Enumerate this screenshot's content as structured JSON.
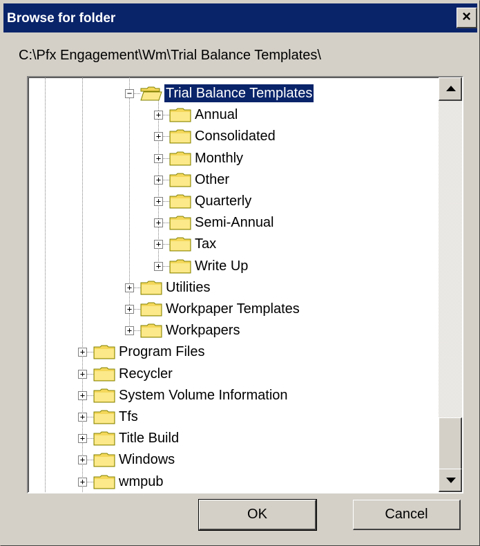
{
  "window": {
    "title": "Browse for folder",
    "close_label": "×"
  },
  "current_path": "C:\\Pfx Engagement\\Wm\\Trial Balance Templates\\",
  "tree": {
    "selected": "Trial Balance Templates",
    "nodes": [
      {
        "label": "Trial Balance Templates",
        "level": 2,
        "expander": "−",
        "open": true,
        "selected": true
      },
      {
        "label": "Annual",
        "level": 3,
        "expander": "+"
      },
      {
        "label": "Consolidated",
        "level": 3,
        "expander": "+"
      },
      {
        "label": "Monthly",
        "level": 3,
        "expander": "+"
      },
      {
        "label": "Other",
        "level": 3,
        "expander": "+"
      },
      {
        "label": "Quarterly",
        "level": 3,
        "expander": "+"
      },
      {
        "label": "Semi-Annual",
        "level": 3,
        "expander": "+"
      },
      {
        "label": "Tax",
        "level": 3,
        "expander": "+"
      },
      {
        "label": "Write Up",
        "level": 3,
        "expander": "+"
      },
      {
        "label": "Utilities",
        "level": 2,
        "expander": "+"
      },
      {
        "label": "Workpaper Templates",
        "level": 2,
        "expander": "+"
      },
      {
        "label": "Workpapers",
        "level": 2,
        "expander": "+"
      },
      {
        "label": "Program Files",
        "level": 1,
        "expander": "+"
      },
      {
        "label": "Recycler",
        "level": 1,
        "expander": "+"
      },
      {
        "label": "System Volume Information",
        "level": 1,
        "expander": "+"
      },
      {
        "label": "Tfs",
        "level": 1,
        "expander": "+"
      },
      {
        "label": "Title Build",
        "level": 1,
        "expander": "+"
      },
      {
        "label": "Windows",
        "level": 1,
        "expander": "+"
      },
      {
        "label": "wmpub",
        "level": 1,
        "expander": "+"
      }
    ]
  },
  "buttons": {
    "ok": "OK",
    "cancel": "Cancel"
  },
  "colors": {
    "selection": "#0a246a",
    "title_bar": "#0a246a",
    "face": "#d4d0c8",
    "folder": "#f4d75a"
  }
}
